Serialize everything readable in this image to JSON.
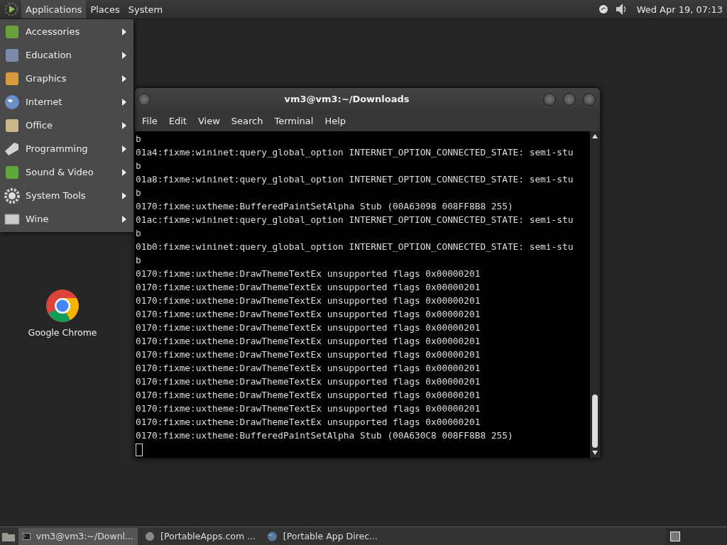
{
  "top_panel": {
    "menus": [
      {
        "label": "Applications",
        "selected": true
      },
      {
        "label": "Places",
        "selected": false
      },
      {
        "label": "System",
        "selected": false
      }
    ],
    "clock": "Wed Apr 19, 07:13"
  },
  "applications_menu": {
    "items": [
      {
        "label": "Accessories",
        "kind": "accessories"
      },
      {
        "label": "Education",
        "kind": "education"
      },
      {
        "label": "Graphics",
        "kind": "graphics"
      },
      {
        "label": "Internet",
        "kind": "internet"
      },
      {
        "label": "Office",
        "kind": "office"
      },
      {
        "label": "Programming",
        "kind": "programming"
      },
      {
        "label": "Sound & Video",
        "kind": "sound"
      },
      {
        "label": "System Tools",
        "kind": "tools"
      },
      {
        "label": "Wine",
        "kind": "wine"
      }
    ]
  },
  "desktop_icons": [
    {
      "label": "Google Chrome"
    }
  ],
  "terminal": {
    "title": "vm3@vm3:~/Downloads",
    "menu": [
      "File",
      "Edit",
      "View",
      "Search",
      "Terminal",
      "Help"
    ],
    "lines": [
      "b",
      "01a4:fixme:wininet:query_global_option INTERNET_OPTION_CONNECTED_STATE: semi-stu",
      "b",
      "01a8:fixme:wininet:query_global_option INTERNET_OPTION_CONNECTED_STATE: semi-stu",
      "b",
      "0170:fixme:uxtheme:BufferedPaintSetAlpha Stub (00A63098 008FF8B8 255)",
      "01ac:fixme:wininet:query_global_option INTERNET_OPTION_CONNECTED_STATE: semi-stu",
      "b",
      "01b0:fixme:wininet:query_global_option INTERNET_OPTION_CONNECTED_STATE: semi-stu",
      "b",
      "0170:fixme:uxtheme:DrawThemeTextEx unsupported flags 0x00000201",
      "0170:fixme:uxtheme:DrawThemeTextEx unsupported flags 0x00000201",
      "0170:fixme:uxtheme:DrawThemeTextEx unsupported flags 0x00000201",
      "0170:fixme:uxtheme:DrawThemeTextEx unsupported flags 0x00000201",
      "0170:fixme:uxtheme:DrawThemeTextEx unsupported flags 0x00000201",
      "0170:fixme:uxtheme:DrawThemeTextEx unsupported flags 0x00000201",
      "0170:fixme:uxtheme:DrawThemeTextEx unsupported flags 0x00000201",
      "0170:fixme:uxtheme:DrawThemeTextEx unsupported flags 0x00000201",
      "0170:fixme:uxtheme:DrawThemeTextEx unsupported flags 0x00000201",
      "0170:fixme:uxtheme:DrawThemeTextEx unsupported flags 0x00000201",
      "0170:fixme:uxtheme:DrawThemeTextEx unsupported flags 0x00000201",
      "0170:fixme:uxtheme:DrawThemeTextEx unsupported flags 0x00000201",
      "0170:fixme:uxtheme:BufferedPaintSetAlpha Stub (00A630C8 008FF8B8 255)"
    ],
    "cursor": true
  },
  "taskbar": {
    "tasks": [
      {
        "label": "vm3@vm3:~/Downl...",
        "kind": "terminal",
        "selected": true
      },
      {
        "label": "[PortableApps.com ...",
        "kind": "app",
        "selected": false
      },
      {
        "label": "[Portable App Direc...",
        "kind": "globe",
        "selected": false
      }
    ]
  }
}
